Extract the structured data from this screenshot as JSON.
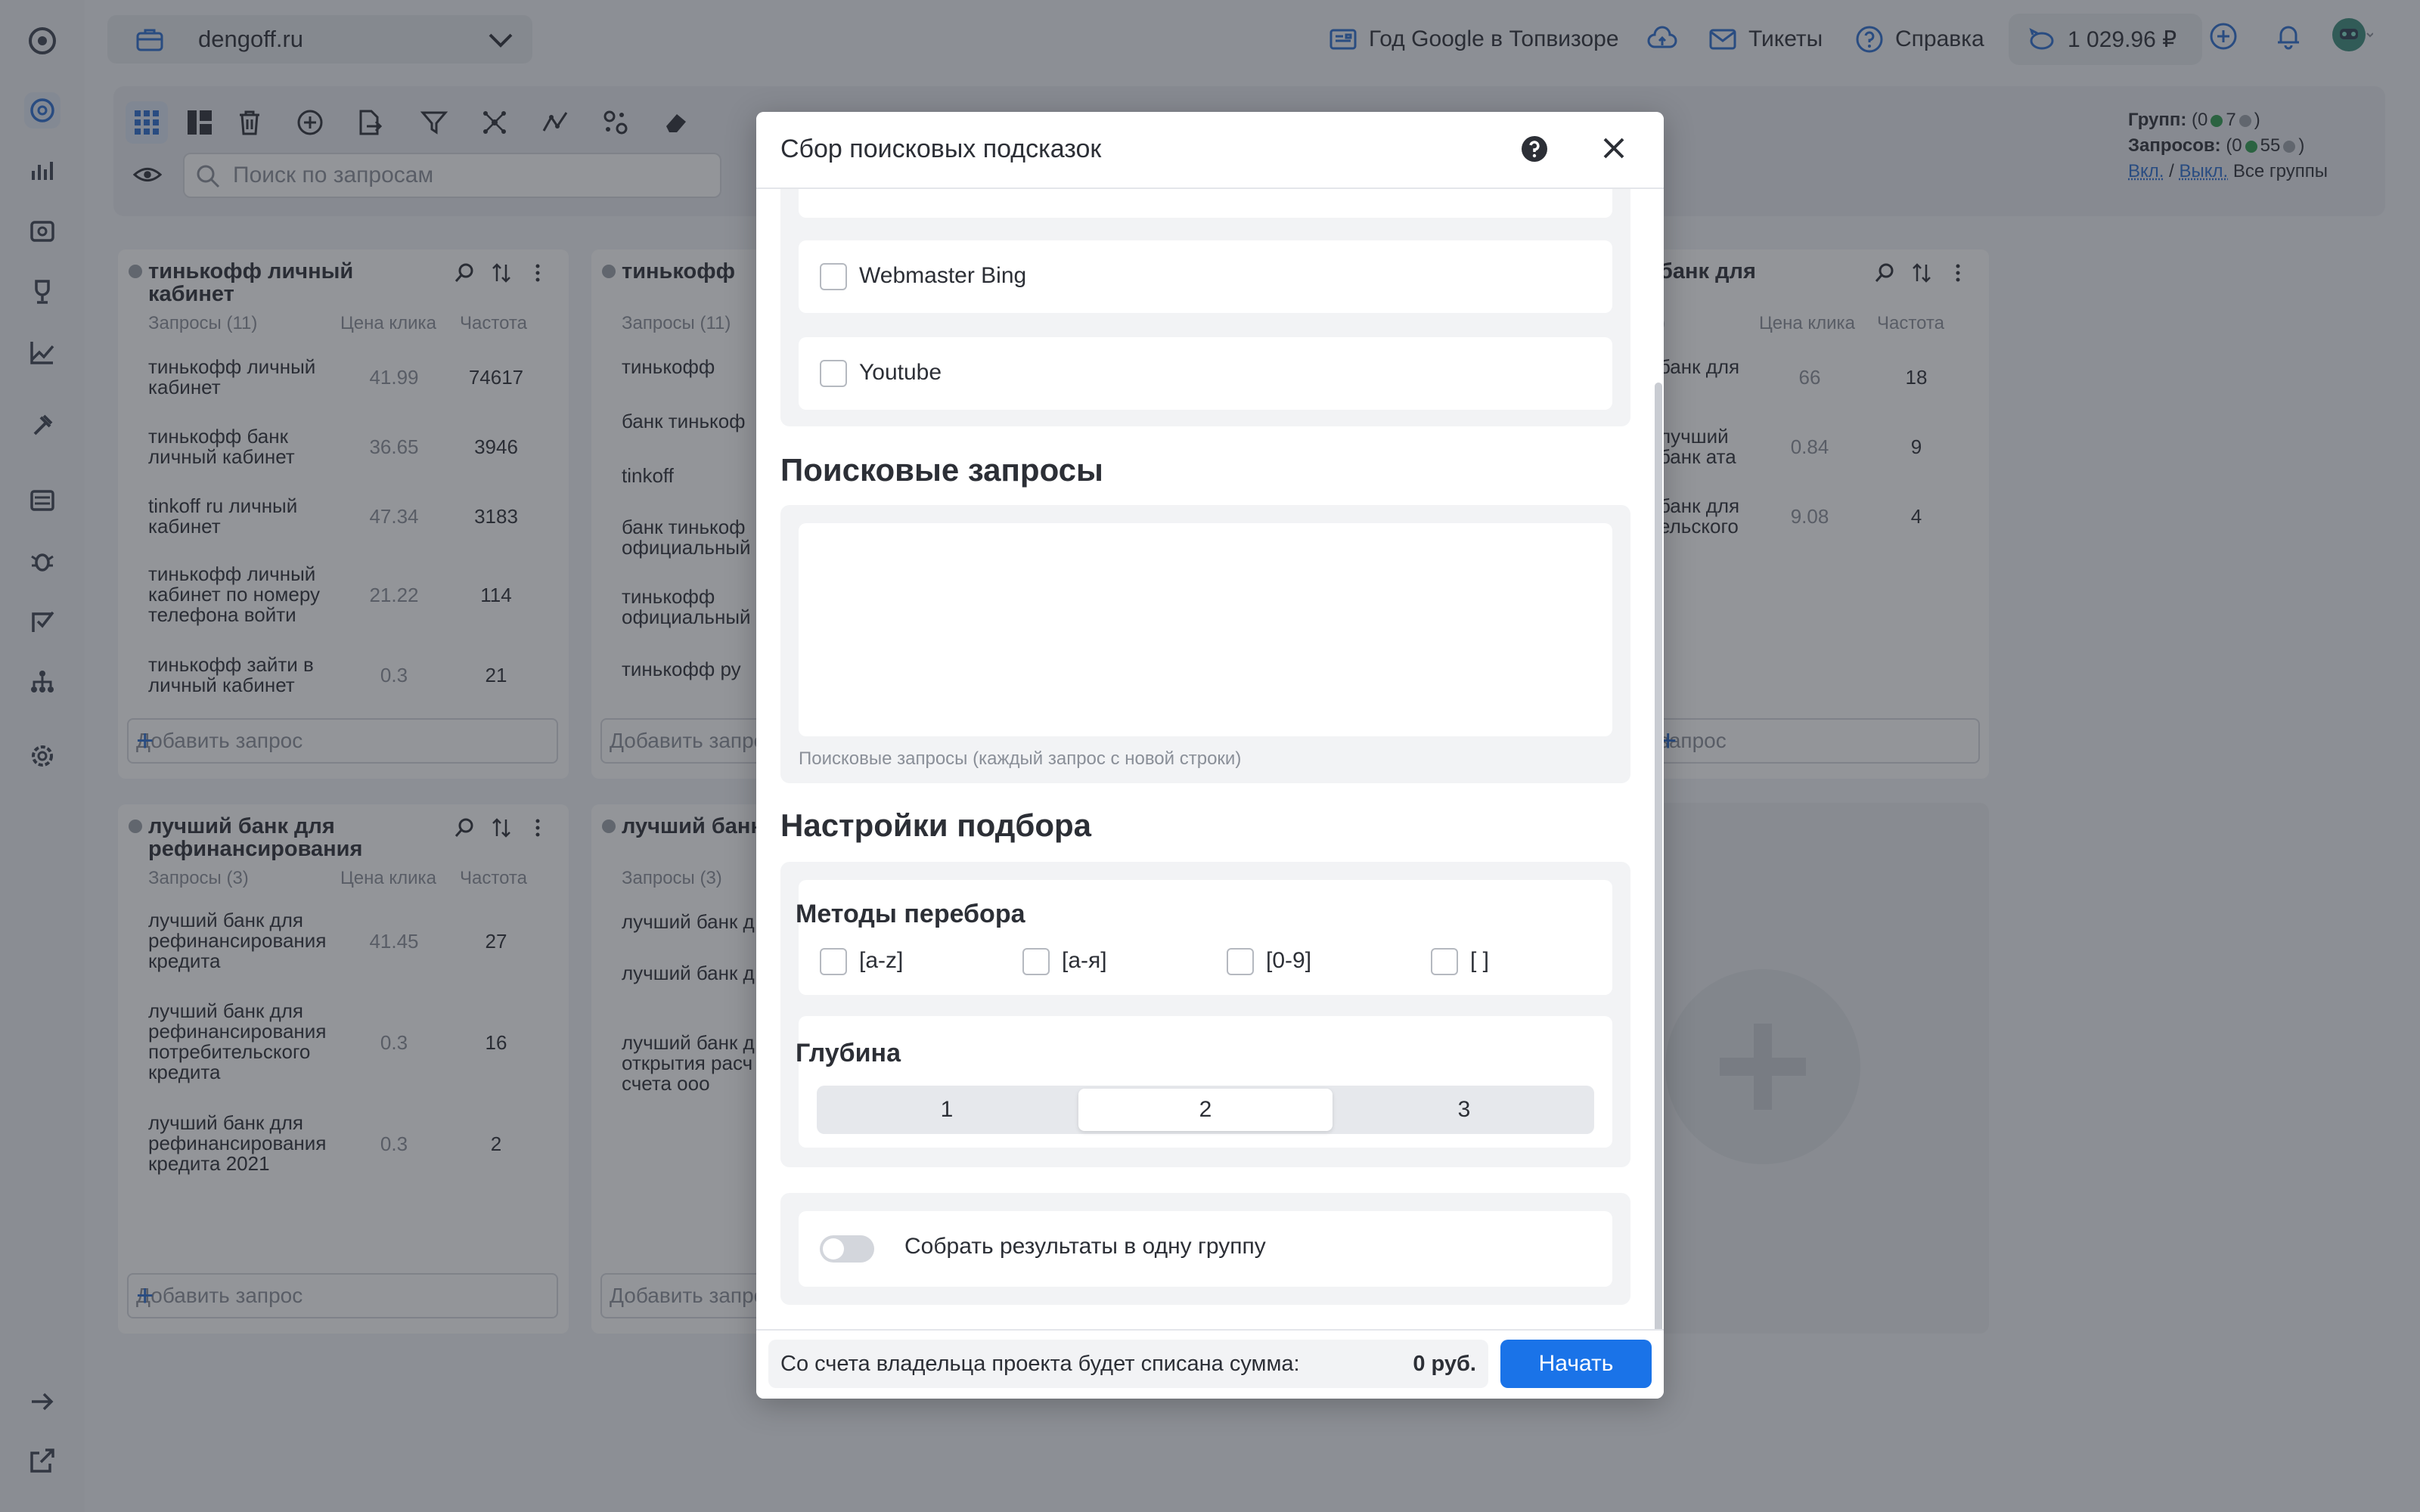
{
  "header": {
    "project": "dengoff.ru",
    "google_year": "Год Google в Топвизоре",
    "tickets": "Тикеты",
    "help": "Справка",
    "balance": "1 029.96 ₽"
  },
  "toolbar": {
    "search_placeholder": "Поиск по запросам",
    "stats": {
      "groups_label": "Групп:",
      "groups_open": "(0",
      "groups_green": "7",
      "groups_close": ")",
      "queries_label": "Запросов:",
      "queries_open": "(0",
      "queries_green": "55",
      "queries_close": ")",
      "on": "Вкл.",
      "slash": "/",
      "off": "Выкл.",
      "all_groups": "Все группы"
    }
  },
  "colors": {
    "accent": "#1a73e8",
    "green": "#2e9b4f",
    "gray": "#9aa0a8"
  },
  "cards": [
    {
      "title": "тинькофф личный кабинет",
      "col_queries": "Запросы (11)",
      "col_price": "Цена клика",
      "col_freq": "Частота",
      "rows": [
        {
          "q": "тинькофф личный кабинет",
          "p": "41.99",
          "f": "74617"
        },
        {
          "q": "тинькофф банк личный кабинет",
          "p": "36.65",
          "f": "3946"
        },
        {
          "q": "tinkoff ru личный кабинет",
          "p": "47.34",
          "f": "3183"
        },
        {
          "q": "тинькофф личный кабинет по номеру телефона войти",
          "p": "21.22",
          "f": "114"
        },
        {
          "q": "тинькофф зайти в личный кабинет",
          "p": "0.3",
          "f": "21"
        }
      ],
      "add": "Добавить запрос"
    },
    {
      "title": "тинькофф",
      "col_queries": "Запросы (11)",
      "rows": [
        {
          "q": "тинькофф"
        },
        {
          "q": "банк тинькоф"
        },
        {
          "q": "tinkoff"
        },
        {
          "q": "банк тинькоф официальный"
        },
        {
          "q": "тинькофф официальный"
        },
        {
          "q": "тинькофф ру"
        }
      ],
      "add": "Добавить запрос"
    },
    {
      "title": "банк для",
      "col_queries": ")",
      "col_price": "Цена клика",
      "col_freq": "Частота",
      "rows": [
        {
          "q": "банк для",
          "p": "66",
          "f": "18"
        },
        {
          "q": "лучший банк ата",
          "p": "0.84",
          "f": "9"
        },
        {
          "q": "банк для ельского",
          "p": "9.08",
          "f": "4"
        }
      ],
      "add": "запрос"
    },
    {
      "title": "лучший банк для рефинансирования",
      "col_queries": "Запросы (3)",
      "col_price": "Цена клика",
      "col_freq": "Частота",
      "rows": [
        {
          "q": "лучший банк для рефинансирования кредита",
          "p": "41.45",
          "f": "27"
        },
        {
          "q": "лучший банк для рефинансирования потребительского кредита",
          "p": "0.3",
          "f": "16"
        },
        {
          "q": "лучший банк для рефинансирования кредита 2021",
          "p": "0.3",
          "f": "2"
        }
      ],
      "add": "Добавить запрос"
    },
    {
      "title": "лучший банк",
      "col_queries": "Запросы (3)",
      "rows": [
        {
          "q": "лучший банк д"
        },
        {
          "q": "лучший банк д лиц"
        },
        {
          "q": "лучший банк д открытия расч счета ооо"
        }
      ],
      "add": "Добавить запрос"
    }
  ],
  "modal": {
    "title": "Сбор поисковых подсказок",
    "sources": [
      "Webmaster Bing",
      "Youtube"
    ],
    "queries_heading": "Поисковые запросы",
    "queries_hint": "Поисковые запросы (каждый запрос с новой строки)",
    "settings_heading": "Настройки подбора",
    "methods_title": "Методы перебора",
    "methods": [
      "[a-z]",
      "[а-я]",
      "[0-9]",
      "[ ]"
    ],
    "depth_title": "Глубина",
    "depth_options": [
      "1",
      "2",
      "3"
    ],
    "depth_selected": "2",
    "merge_label": "Собрать результаты в одну группу",
    "footer_text": "Со счета владельца проекта будет списана сумма:",
    "footer_sum": "0 руб.",
    "start": "Начать"
  }
}
